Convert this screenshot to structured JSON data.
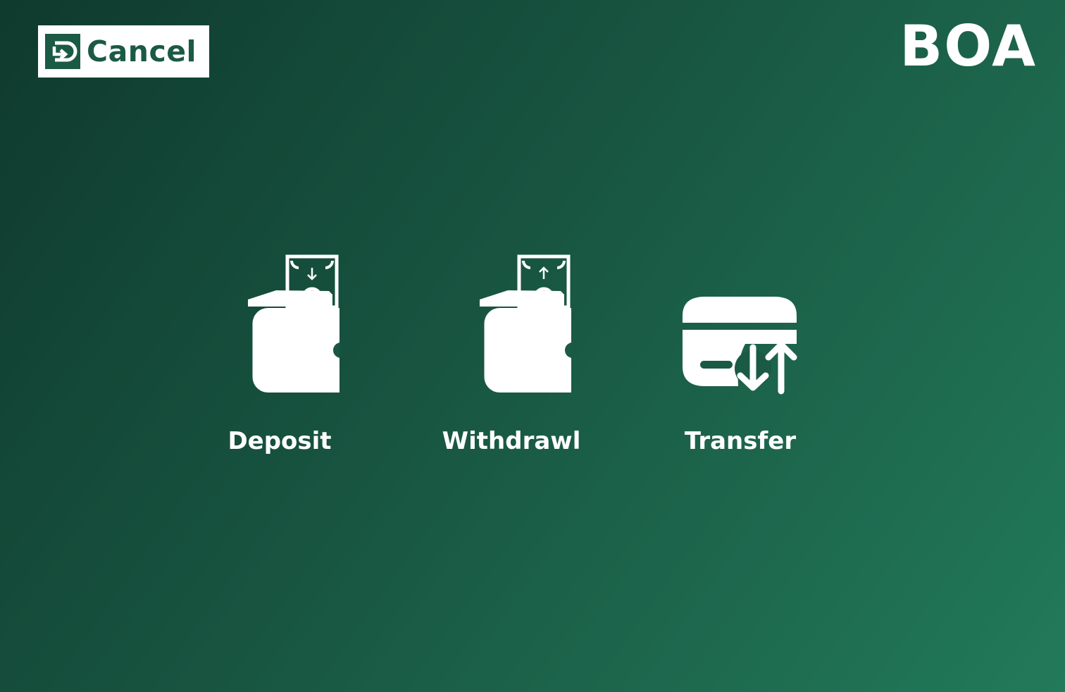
{
  "header": {
    "cancel_label": "Cancel",
    "brand": "BOA"
  },
  "options": [
    {
      "label": "Deposit",
      "icon": "wallet-deposit-icon"
    },
    {
      "label": "Withdrawl",
      "icon": "wallet-withdraw-icon"
    },
    {
      "label": "Transfer",
      "icon": "card-transfer-icon"
    }
  ],
  "colors": {
    "background_start": "#0f3a2e",
    "background_end": "#227a5a",
    "accent": "#1b5a45",
    "foreground": "#ffffff"
  }
}
